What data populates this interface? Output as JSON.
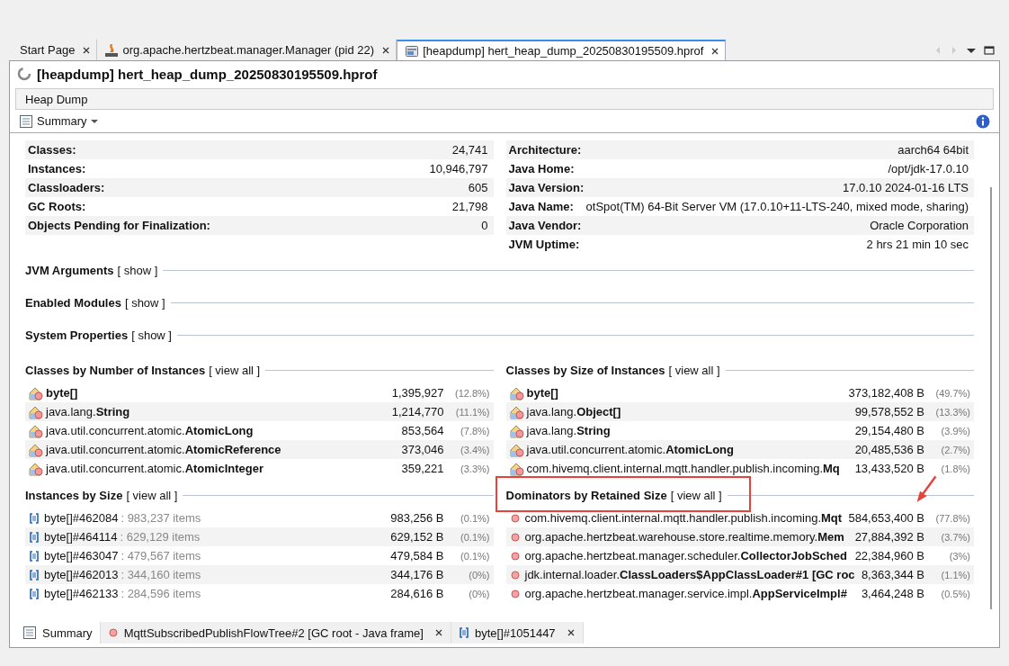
{
  "editor_tabs": [
    {
      "label": "Start Page",
      "kind": "plain",
      "selected": false
    },
    {
      "label": "org.apache.hertzbeat.manager.Manager (pid 22)",
      "kind": "jmx",
      "selected": false
    },
    {
      "label": "[heapdump] hert_heap_dump_20250830195509.hprof",
      "kind": "heapdump",
      "selected": true
    }
  ],
  "title": "[heapdump] hert_heap_dump_20250830195509.hprof",
  "section_bar": "Heap Dump",
  "view_selector": "Summary",
  "summary_left": [
    {
      "label": "Classes:",
      "value": "24,741"
    },
    {
      "label": "Instances:",
      "value": "10,946,797"
    },
    {
      "label": "Classloaders:",
      "value": "605"
    },
    {
      "label": "GC Roots:",
      "value": "21,798"
    },
    {
      "label": "Objects Pending for Finalization:",
      "value": "0"
    }
  ],
  "summary_right": [
    {
      "label": "Architecture:",
      "value": "aarch64 64bit"
    },
    {
      "label": "Java Home:",
      "value": "/opt/jdk-17.0.10"
    },
    {
      "label": "Java Version:",
      "value": "17.0.10 2024-01-16 LTS"
    },
    {
      "label": "Java Name:",
      "value": "otSpot(TM) 64-Bit Server VM (17.0.10+11-LTS-240, mixed mode, sharing)"
    },
    {
      "label": "Java Vendor:",
      "value": "Oracle Corporation"
    },
    {
      "label": "JVM Uptime:",
      "value": "2 hrs 21 min 10 sec"
    }
  ],
  "collapsed_sections": [
    {
      "title": "JVM Arguments",
      "link": "[ show ]"
    },
    {
      "title": "Enabled Modules",
      "link": "[ show ]"
    },
    {
      "title": "System Properties",
      "link": "[ show ]"
    }
  ],
  "tables": [
    {
      "title": "Classes by Number of Instances",
      "link": "[ view all ]",
      "kind": "class",
      "highlighted": false,
      "rows": [
        {
          "name": "**byte[]**",
          "value": "1,395,927",
          "percent": "(12.8%)"
        },
        {
          "name": "java.lang.**String**",
          "value": "1,214,770",
          "percent": "(11.1%)"
        },
        {
          "name": "java.util.concurrent.atomic.**AtomicLong**",
          "value": "853,564",
          "percent": "(7.8%)"
        },
        {
          "name": "java.util.concurrent.atomic.**AtomicReference**",
          "value": "373,046",
          "percent": "(3.4%)"
        },
        {
          "name": "java.util.concurrent.atomic.**AtomicInteger**",
          "value": "359,221",
          "percent": "(3.3%)"
        }
      ]
    },
    {
      "title": "Classes by Size of Instances",
      "link": "[ view all ]",
      "kind": "class",
      "highlighted": false,
      "rows": [
        {
          "name": "**byte[]**",
          "value": "373,182,408 B",
          "percent": "(49.7%)"
        },
        {
          "name": "java.lang.**Object[]**",
          "value": "99,578,552 B",
          "percent": "(13.3%)"
        },
        {
          "name": "java.lang.**String**",
          "value": "29,154,480 B",
          "percent": "(3.9%)"
        },
        {
          "name": "java.util.concurrent.atomic.**AtomicLong**",
          "value": "20,485,536 B",
          "percent": "(2.7%)"
        },
        {
          "name": "com.hivemq.client.internal.mqtt.handler.publish.incoming.**Mq**",
          "value": "13,433,520 B",
          "percent": "(1.8%)"
        }
      ]
    },
    {
      "title": "Instances by Size",
      "link": "[ view all ]",
      "kind": "instance",
      "highlighted": false,
      "rows": [
        {
          "name": "byte[]#462084",
          "detail": ": 983,237 items",
          "value": "983,256 B",
          "percent": "(0.1%)"
        },
        {
          "name": "byte[]#464114",
          "detail": ": 629,129 items",
          "value": "629,152 B",
          "percent": "(0.1%)"
        },
        {
          "name": "byte[]#463047",
          "detail": ": 479,567 items",
          "value": "479,584 B",
          "percent": "(0.1%)"
        },
        {
          "name": "byte[]#462013",
          "detail": ": 344,160 items",
          "value": "344,176 B",
          "percent": "(0%)"
        },
        {
          "name": "byte[]#462133",
          "detail": ": 284,596 items",
          "value": "284,616 B",
          "percent": "(0%)"
        }
      ]
    },
    {
      "title": "Dominators by Retained Size",
      "link": "[ view all ]",
      "kind": "dominator",
      "highlighted": true,
      "rows": [
        {
          "name": "com.hivemq.client.internal.mqtt.handler.publish.incoming.**Mqt**",
          "value": "584,653,400 B",
          "percent": "(77.8%)"
        },
        {
          "name": "org.apache.hertzbeat.warehouse.store.realtime.memory.**Mem**",
          "value": "27,884,392 B",
          "percent": "(3.7%)"
        },
        {
          "name": "org.apache.hertzbeat.manager.scheduler.**CollectorJobSched**",
          "value": "22,384,960 B",
          "percent": "(3%)"
        },
        {
          "name": "jdk.internal.loader.**ClassLoaders$AppClassLoader#1 [GC roc**",
          "value": "8,363,344 B",
          "percent": "(1.1%)"
        },
        {
          "name": "org.apache.hertzbeat.manager.service.impl.**AppServiceImpl#**",
          "value": "3,464,248 B",
          "percent": "(0.5%)"
        }
      ]
    }
  ],
  "bottom_tabs": [
    {
      "label": "Summary",
      "kind": "summary",
      "selected": true
    },
    {
      "label": "MqttSubscribedPublishFlowTree#2 [GC root - Java frame]",
      "kind": "dominator",
      "selected": false
    },
    {
      "label": "byte[]#1051447",
      "kind": "instance",
      "selected": false
    }
  ]
}
